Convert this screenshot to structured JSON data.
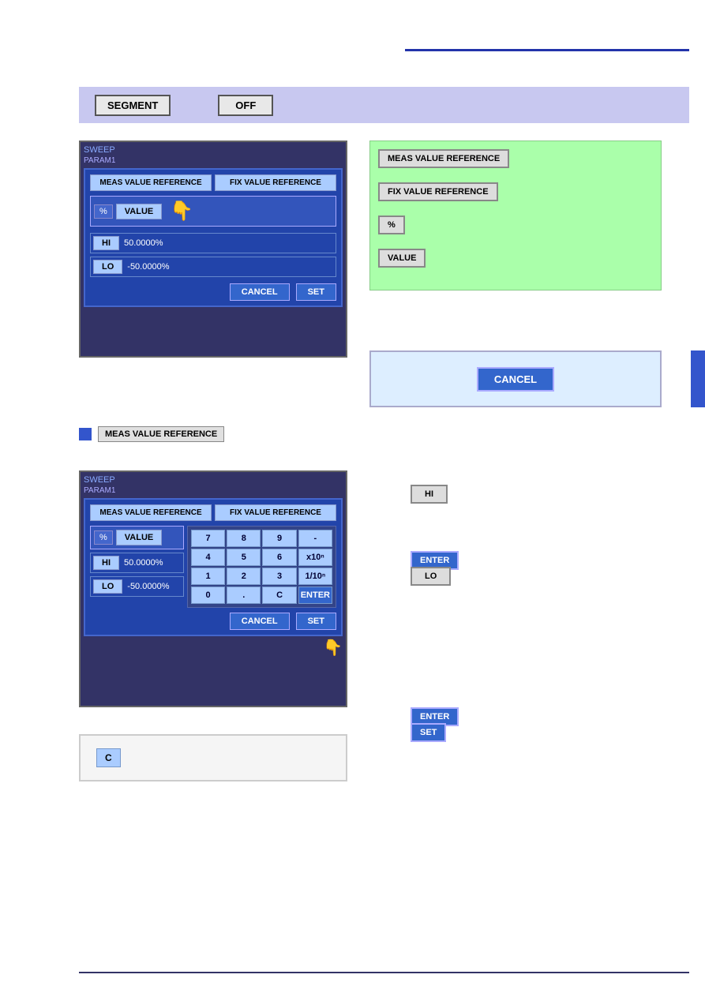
{
  "header": {
    "segment_label": "SEGMENT",
    "off_label": "OFF"
  },
  "top_screenshot": {
    "sweep_title": "SWEEP",
    "param_title": "PARAM1",
    "meas_ref_label": "MEAS VALUE REFERENCE",
    "fix_ref_label": "FIX VALUE REFERENCE",
    "unit": "%",
    "value_btn": "VALUE",
    "hi_label": "HI",
    "hi_value": "50.0000%",
    "lo_label": "LO",
    "lo_value": "-50.0000%",
    "cancel_label": "CANCEL",
    "set_label": "SET"
  },
  "right_top": {
    "meas_ref_label": "MEAS VALUE REFERENCE",
    "fix_ref_label": "FIX VALUE REFERENCE",
    "pct_label": "%",
    "value_label": "VALUE",
    "cancel_label": "CANCEL"
  },
  "meas_indicator": {
    "label": "MEAS VALUE REFERENCE"
  },
  "bottom_screenshot": {
    "sweep_title": "SWEEP",
    "param_title": "PARAM1",
    "meas_ref_label": "MEAS VALUE REFERENCE",
    "fix_ref_label": "FIX VALUE REFERENCE",
    "unit": "%",
    "value_btn": "VALUE",
    "hi_label": "HI",
    "hi_value": "50.0000%",
    "lo_label": "LO",
    "lo_value": "-50.0000%",
    "cancel_label": "CANCEL",
    "set_label": "SET",
    "numpad": {
      "7": "7",
      "8": "8",
      "9": "9",
      "minus": "-",
      "4": "4",
      "5": "5",
      "6": "6",
      "x10n": "x10ⁿ",
      "1": "1",
      "2": "2",
      "3": "3",
      "inv": "1/10ⁿ",
      "0": "0",
      "dot": ".",
      "c": "C",
      "enter": "ENTER"
    }
  },
  "right_bottom": {
    "hi_label": "HI",
    "enter_label": "ENTER",
    "lo_label": "LO",
    "enter2_label": "ENTER",
    "set_label": "SET"
  },
  "c_box": {
    "c_label": "C"
  }
}
